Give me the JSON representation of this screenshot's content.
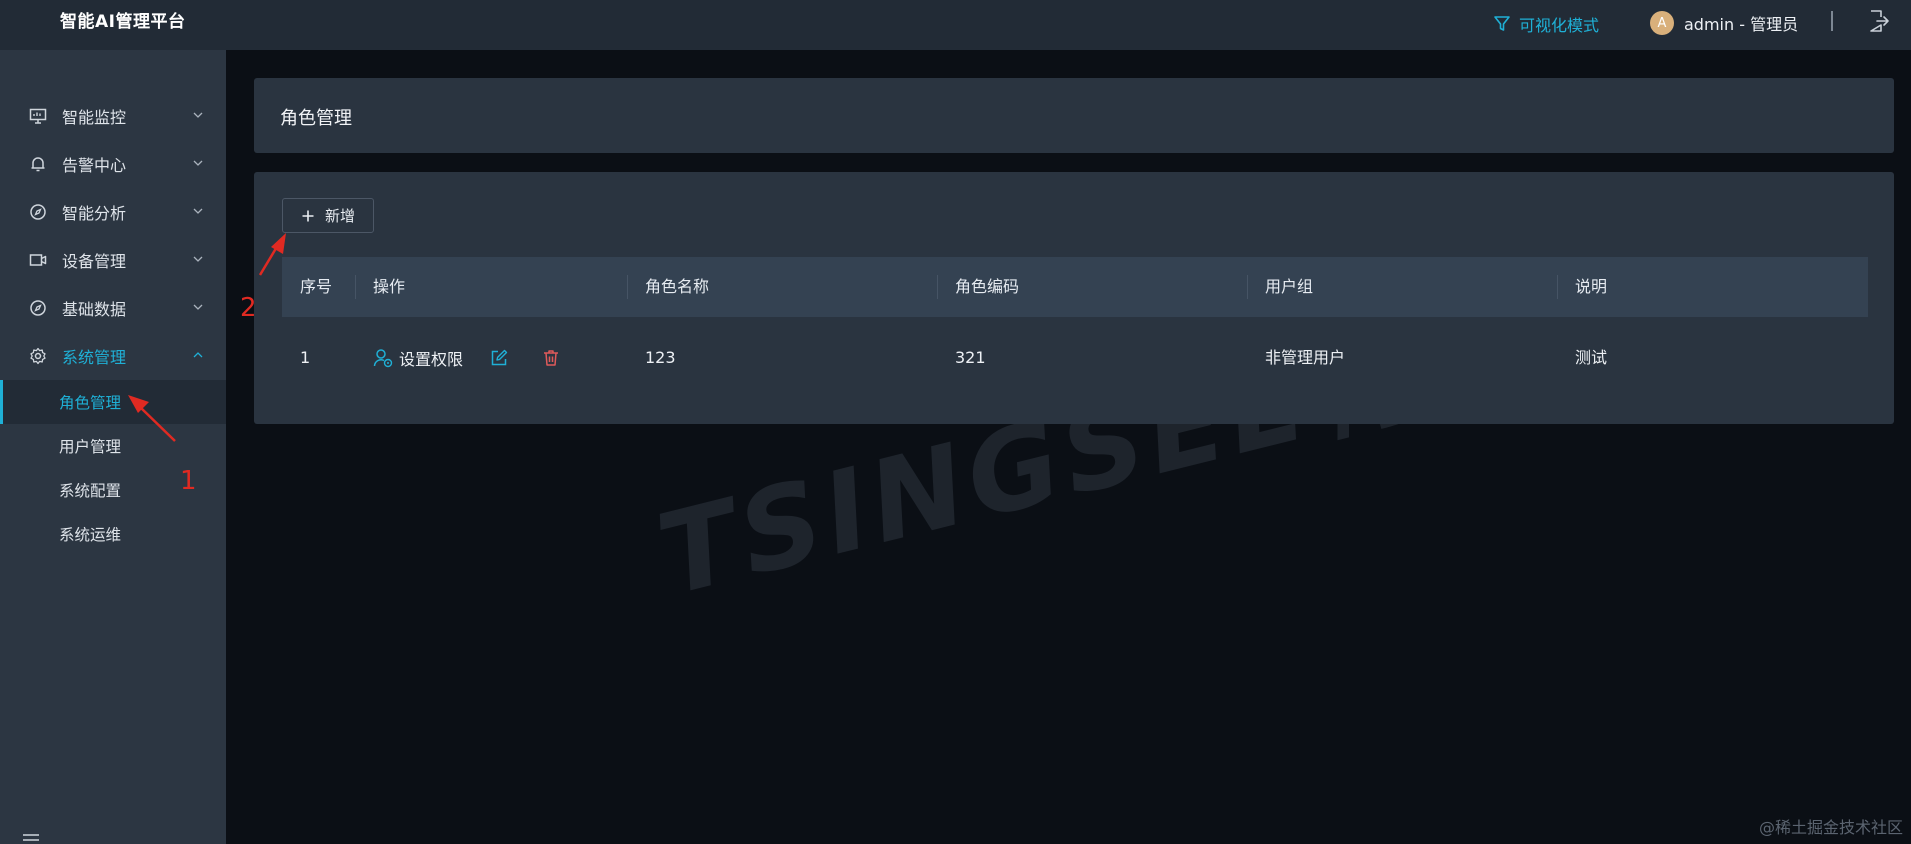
{
  "header": {
    "brand": "智能AI管理平台",
    "vis_mode": "可视化模式",
    "avatar_letter": "A",
    "user": "admin - 管理员"
  },
  "sidebar": {
    "items": [
      {
        "label": "智能监控",
        "icon": "monitor-icon"
      },
      {
        "label": "告警中心",
        "icon": "bell-icon"
      },
      {
        "label": "智能分析",
        "icon": "compass-icon"
      },
      {
        "label": "设备管理",
        "icon": "camera-icon"
      },
      {
        "label": "基础数据",
        "icon": "compass-icon"
      },
      {
        "label": "系统管理",
        "icon": "gear-icon",
        "expanded": true
      }
    ],
    "sub_items": [
      {
        "label": "角色管理",
        "active": true
      },
      {
        "label": "用户管理"
      },
      {
        "label": "系统配置"
      },
      {
        "label": "系统运维"
      }
    ]
  },
  "main": {
    "title": "角色管理",
    "add_label": "新增",
    "table": {
      "columns": [
        "序号",
        "操作",
        "角色名称",
        "角色编码",
        "用户组",
        "说明"
      ],
      "rows": [
        {
          "index": "1",
          "perm_label": "设置权限",
          "name": "123",
          "code": "321",
          "group": "非管理用户",
          "desc": "测试"
        }
      ]
    }
  },
  "watermark": "TSINGSEE青犀视频",
  "credit": "@稀土掘金技术社区",
  "annotations": {
    "one": "1",
    "two": "2"
  },
  "colors": {
    "accent": "#1fb0d6",
    "danger": "#e05a5a",
    "annotation": "#e02a22",
    "header_bg": "#222b36",
    "sidebar_bg": "#2c3642",
    "panel_bg": "#2a3440"
  }
}
